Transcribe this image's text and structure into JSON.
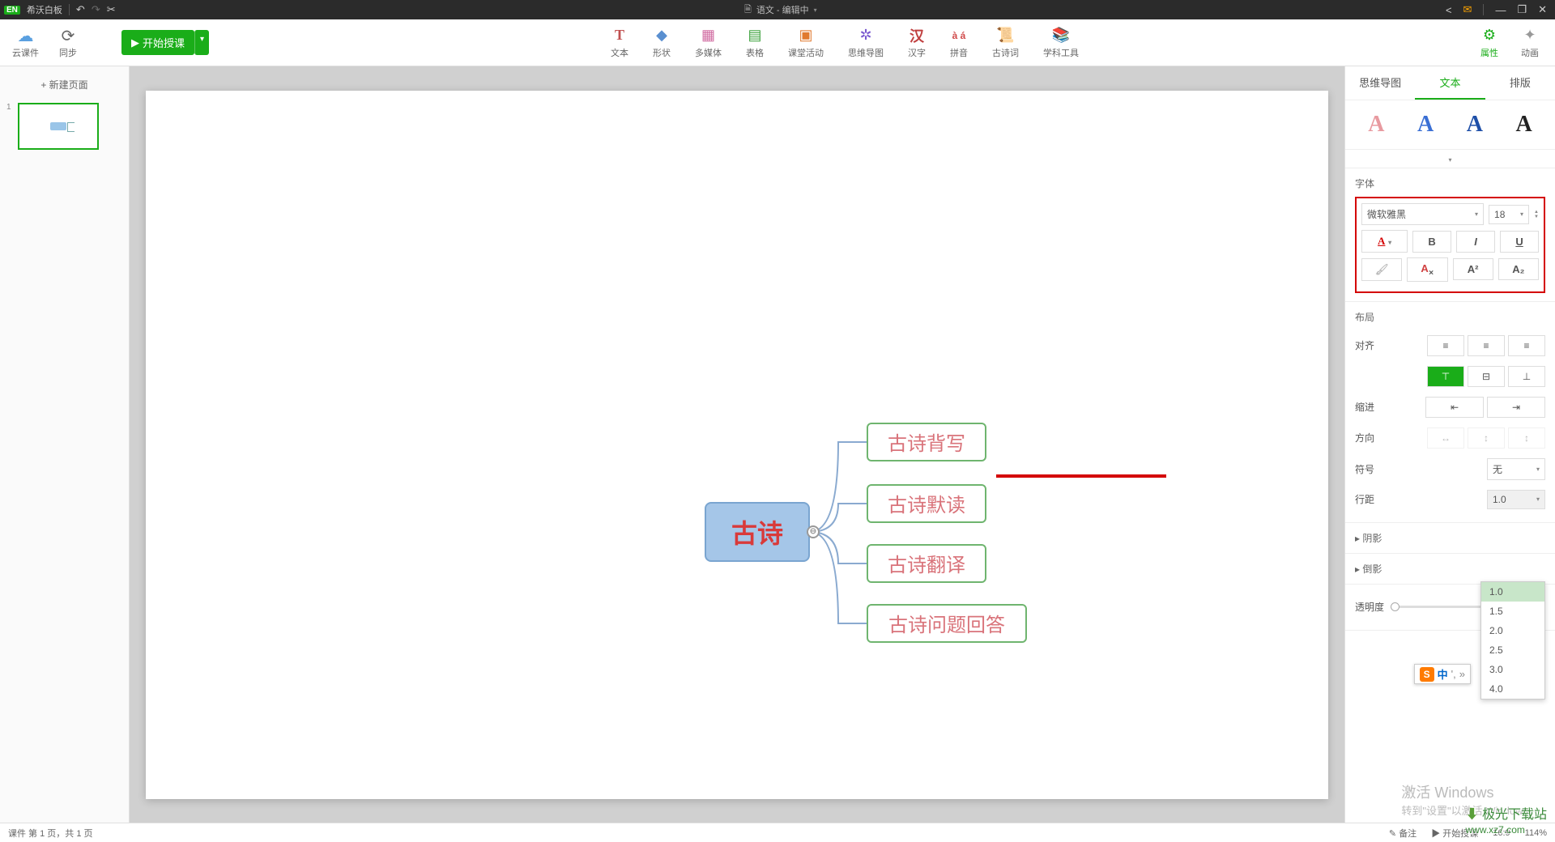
{
  "titlebar": {
    "badge": "EN",
    "app_name": "希沃白板",
    "doc_title": "语文 - 编辑中"
  },
  "toolbar_left": {
    "cloud": "云课件",
    "sync": "同步",
    "start_class": "开始授课"
  },
  "tools": {
    "text": "文本",
    "shape": "形状",
    "media": "多媒体",
    "table": "表格",
    "activity": "课堂活动",
    "mindmap": "思维导图",
    "hanzi": "汉字",
    "pinyin": "拼音",
    "poem": "古诗词",
    "subject": "学科工具"
  },
  "toolbar_right": {
    "props": "属性",
    "anim": "动画"
  },
  "slide_panel": {
    "new_page": "+ 新建页面",
    "num": "1"
  },
  "mindmap": {
    "root": "古诗",
    "collapse": "⊖",
    "children": [
      "古诗背写",
      "古诗默读",
      "古诗翻译",
      "古诗问题回答"
    ]
  },
  "rp": {
    "tabs": {
      "mindmap": "思维导图",
      "text": "文本",
      "layout": "排版"
    },
    "font_section": "字体",
    "font_family": "微软雅黑",
    "font_size": "18",
    "bold": "B",
    "italic": "I",
    "underline": "U",
    "layout_section": "布局",
    "align": "对齐",
    "indent": "缩进",
    "direction": "方向",
    "symbol": "符号",
    "symbol_val": "无",
    "line_spacing": "行距",
    "line_spacing_val": "1.0",
    "line_spacing_opts": [
      "1.0",
      "1.5",
      "2.0",
      "2.5",
      "3.0",
      "4.0"
    ],
    "shadow": "阴影",
    "reflection": "倒影",
    "opacity": "透明度",
    "opacity_val": "0"
  },
  "ime": {
    "badge": "S",
    "lang": "中",
    "punct": "',",
    "arrow": "»"
  },
  "statusbar": {
    "page_info": "课件 第 1 页，共 1 页",
    "note": "备注",
    "start": "开始授课",
    "ratio": "16:9",
    "zoom": "114%"
  },
  "watermark": {
    "line1": "激活 Windows",
    "line2": "转到\"设置\"以激活 Windows。",
    "site1": "极光下载站",
    "site2": "www.xz7.com"
  }
}
